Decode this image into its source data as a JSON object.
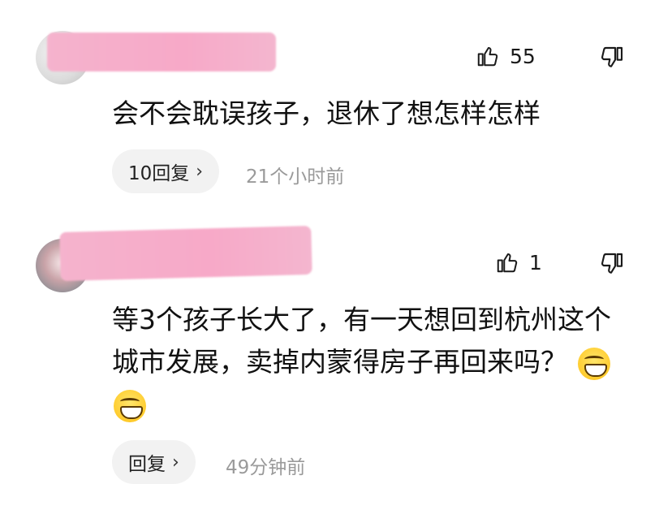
{
  "comments": [
    {
      "likes": "55",
      "text": "会不会耽误孩子，退休了想怎样怎样",
      "reply_label": "10回复",
      "time": "21个小时前"
    },
    {
      "likes": "1",
      "text": "等3个孩子长大了，有一天想回到杭州这个城市发展，卖掉内蒙得房子再回来吗？",
      "reply_label": "回复",
      "time": "49分钟前"
    }
  ],
  "icons": {
    "like": "thumbs-up-icon",
    "dislike": "thumbs-down-icon",
    "chevron": "chevron-right-icon",
    "emoji": "grinning-face-emoji"
  },
  "colors": {
    "name_redaction": "#f7a9c8",
    "time_text": "#9a9a9a",
    "reply_bg": "#f2f2f2"
  }
}
